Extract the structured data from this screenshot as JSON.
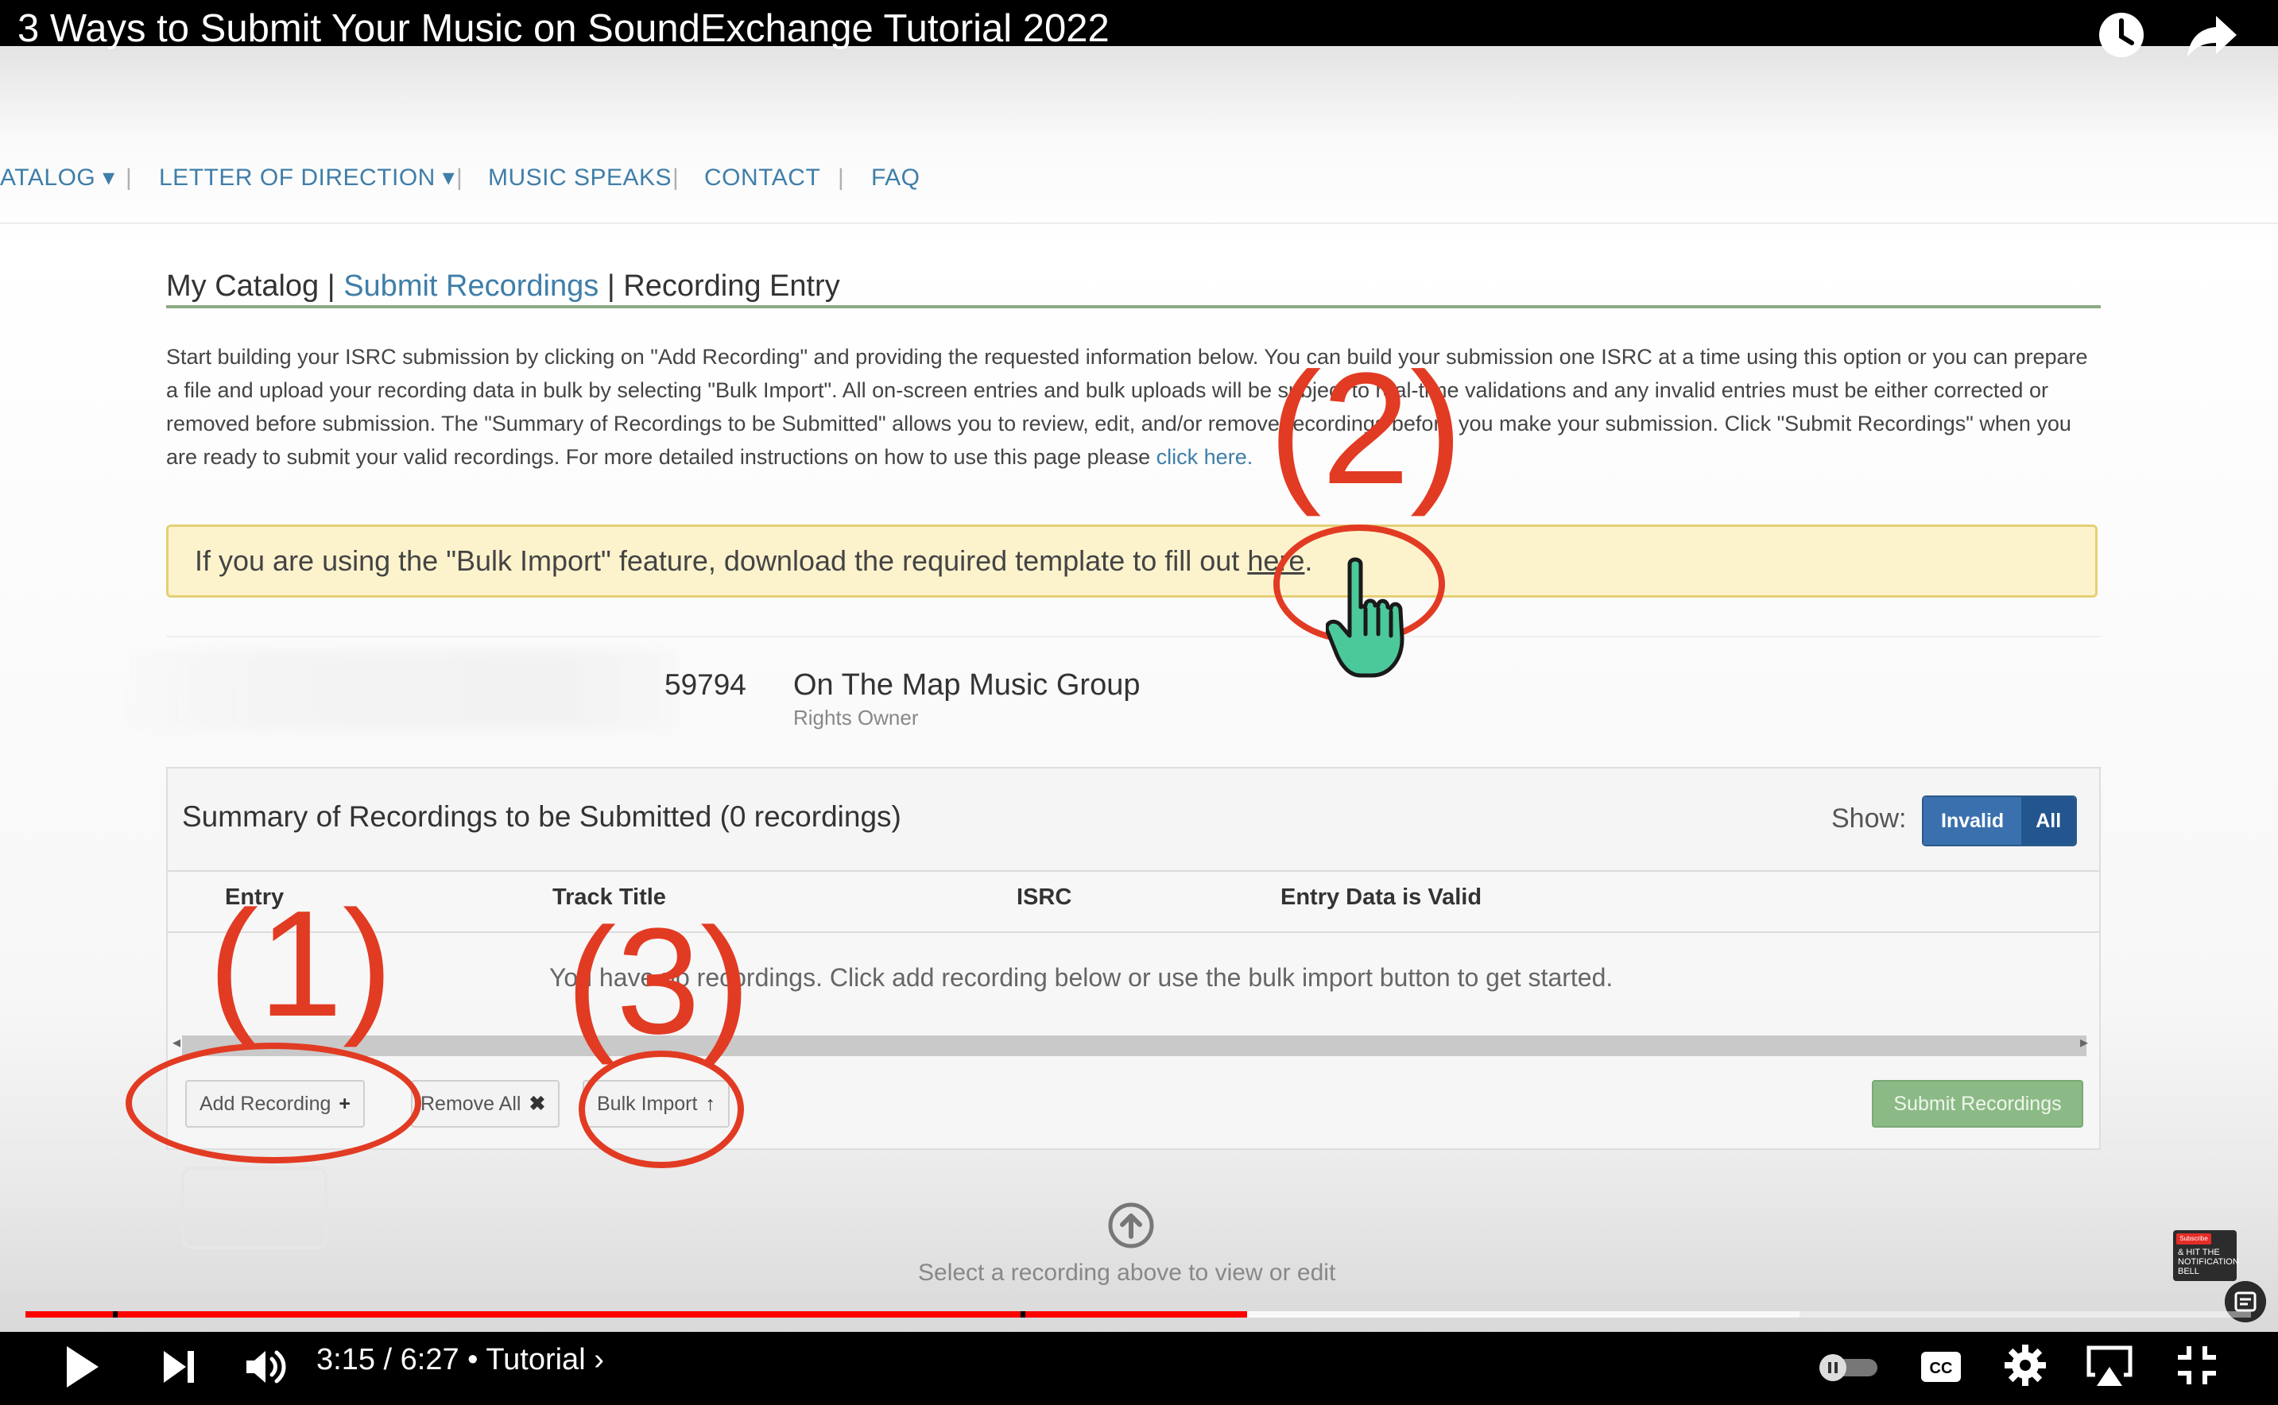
{
  "video": {
    "title": "3 Ways to Submit Your Music on SoundExchange Tutorial 2022",
    "time": "3:15 / 6:27",
    "chapter": "• Tutorial",
    "chapter_chevron": "›",
    "progress_played": 0.549,
    "progress_buffered": 0.797,
    "icons": [
      "watch-later-icon",
      "share-icon",
      "play-icon",
      "next-icon",
      "volume-icon",
      "autoplay-toggle-icon",
      "captions-icon",
      "settings-icon",
      "airplay-icon",
      "exit-fullscreen-icon"
    ]
  },
  "nav": {
    "items": [
      "ATALOG ▾",
      "LETTER OF DIRECTION ▾",
      "MUSIC SPEAKS",
      "CONTACT",
      "FAQ"
    ],
    "separator": "|"
  },
  "breadcrumb": {
    "part1": "My Catalog",
    "sep": "|",
    "part2": "Submit Recordings",
    "part3": "Recording Entry"
  },
  "intro": {
    "text": "Start building your ISRC submission by clicking on \"Add Recording\" and providing the requested information below. You can build your submission one ISRC at a time using this option or you can prepare a file and upload your recording data in bulk by selecting \"Bulk Import\". All on-screen entries and bulk uploads will be subject to real-time validations and any invalid entries must be either corrected or removed before submission. The \"Summary of Recordings to be Submitted\" allows you to review, edit, and/or remove recordings before you make your submission. Click \"Submit Recordings\" when you are ready to submit your valid recordings. For more detailed instructions on how to use this page please",
    "link": "click here."
  },
  "alert": {
    "text": "If you are using the \"Bulk Import\" feature, download the required template to fill out",
    "link": "here",
    "trail": "."
  },
  "owner": {
    "id_fragment": "59794",
    "name": "On The Map Music Group",
    "role": "Rights Owner"
  },
  "summary": {
    "title": "Summary of Recordings to be Submitted (0 recordings)",
    "show_label": "Show:",
    "toggle": [
      "Invalid",
      "All"
    ],
    "columns": [
      "Entry",
      "Track Title",
      "ISRC",
      "Entry Data is Valid"
    ],
    "empty_message": "You have no recordings. Click add recording below or use the bulk import button to get started.",
    "buttons": {
      "add": "Add Recording",
      "add_icon": "+",
      "remove": "Remove All",
      "remove_icon": "✖",
      "bulk": "Bulk Import",
      "bulk_icon": "↑",
      "submit": "Submit Recordings"
    }
  },
  "select_hint": "Select a recording above to view or edit",
  "annotations": {
    "one": "(1)",
    "two": "(2)",
    "three": "(3)",
    "color": "#e23b23"
  },
  "watermark": {
    "subscribe": "Subscribe",
    "text": "& HIT THE NOTIFICATION BELL"
  },
  "colors": {
    "link_blue": "#3f7ea9",
    "alert_bg": "#fcf3cd",
    "submit_green": "#8cba86",
    "toggle_blue": "#3a70ad",
    "progress_red": "#ff0000"
  }
}
